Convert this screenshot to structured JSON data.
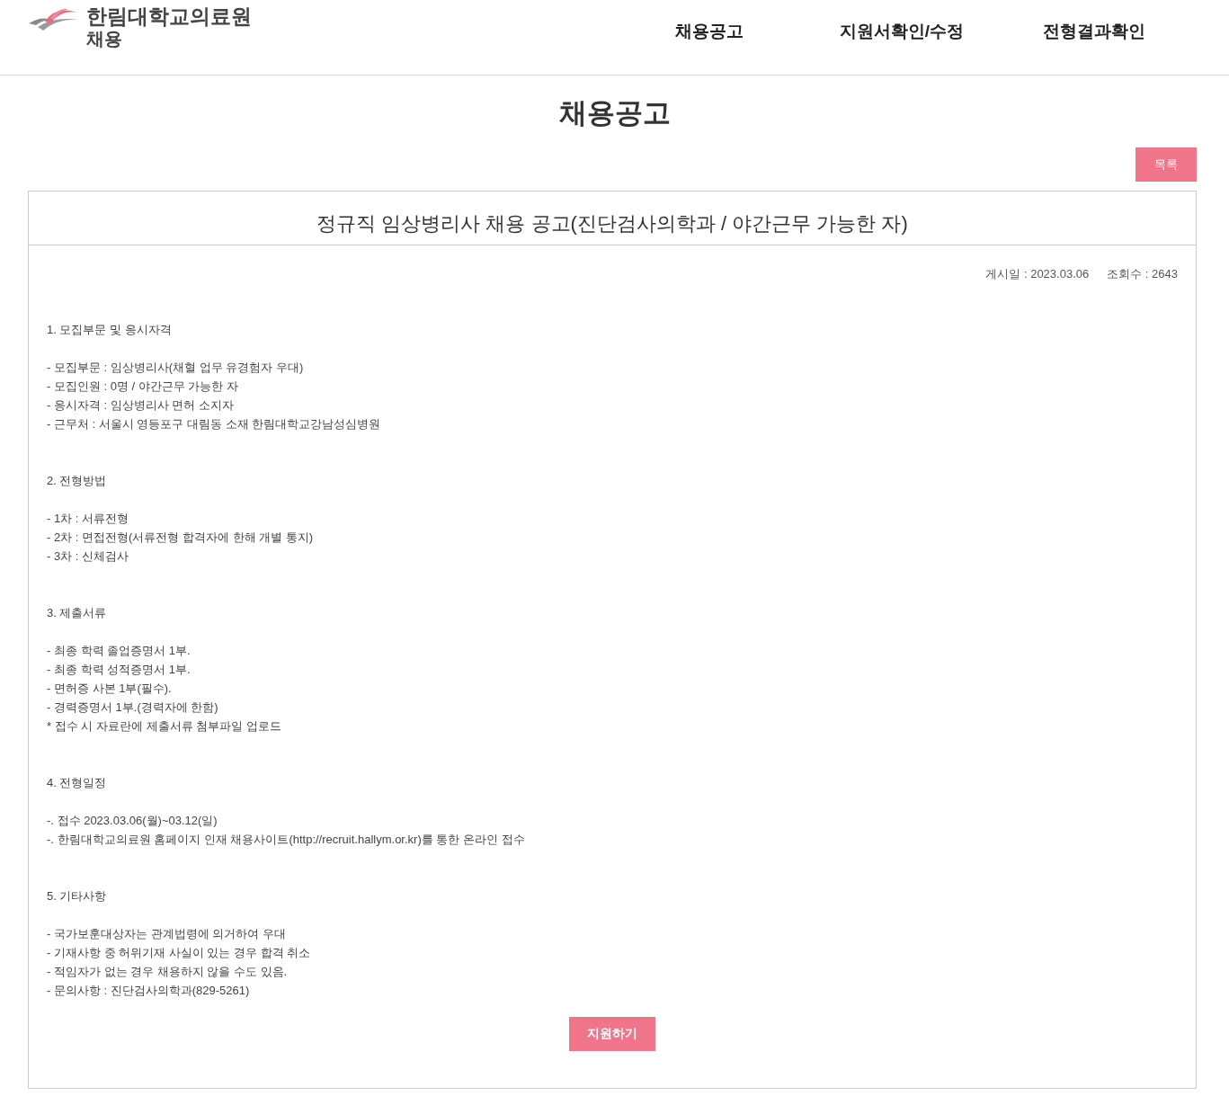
{
  "header": {
    "logo_line1": "한림대학교의료원",
    "logo_line2": "채용",
    "nav": [
      {
        "label": "채용공고"
      },
      {
        "label": "지원서확인/수정"
      },
      {
        "label": "전형결과확인"
      }
    ]
  },
  "page_title": "채용공고",
  "list_button": "목록",
  "post": {
    "title": "정규직 임상병리사 채용 공고(진단검사의학과 / 야간근무 가능한 자)",
    "date": "게시일 : 2023.03.06",
    "views": "조회수 : 2643",
    "sections": [
      {
        "heading": "1. 모집부문 및 응시자격",
        "lines": [
          "- 모집부문 : 임상병리사(채혈 업무 유경험자 우대)",
          "- 모집인원 : 0명 / 야간근무 가능한 자",
          "- 응시자격 : 임상병리사 면허 소지자",
          "- 근무처 : 서울시 영등포구 대림동 소재 한림대학교강남성심병원"
        ]
      },
      {
        "heading": "2. 전형방법",
        "lines": [
          "- 1차 : 서류전형",
          "- 2차 : 면접전형(서류전형 합격자에 한해 개별 통지)",
          "- 3차 : 신체검사"
        ]
      },
      {
        "heading": "3. 제출서류",
        "lines": [
          "- 최종 학력 졸업증명서 1부.",
          "- 최종 학력 성적증명서 1부.",
          "- 면허증 사본 1부(필수).",
          "- 경력증명서 1부.(경력자에 한함)",
          "* 접수 시 자료란에 제출서류 첨부파일 업로드"
        ]
      },
      {
        "heading": "4. 전형일정",
        "lines": [
          "-. 접수 2023.03.06(월)~03.12(일)",
          "-. 한림대학교의료원 홈페이지 인재 채용사이트(http://recruit.hallym.or.kr)를 통한 온라인 접수"
        ]
      },
      {
        "heading": "5. 기타사항",
        "lines": [
          "- 국가보훈대상자는 관계법령에 의거하여 우대",
          "- 기재사항 중 허위기재 사실이 있는 경우 합격 취소",
          "- 적임자가 없는 경우 채용하지 않을 수도 있음.",
          "- 문의사항 : 진단검사의학과(829-5261)"
        ]
      }
    ],
    "apply_button": "지원하기"
  }
}
